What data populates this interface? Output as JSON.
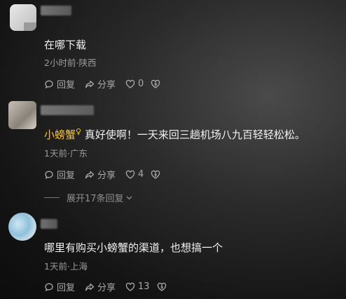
{
  "comments": [
    {
      "text": "在哪下载",
      "time": "2小时前",
      "location": "陕西",
      "reply_label": "回复",
      "share_label": "分享",
      "likes": "0"
    },
    {
      "nickname": "小螃蟹",
      "text": "真好使啊！一天来回三趟机场八九百轻轻松松。",
      "time": "1天前",
      "location": "广东",
      "reply_label": "回复",
      "share_label": "分享",
      "likes": "4",
      "expand_label": "展开17条回复"
    },
    {
      "text": "哪里有购买小螃蟹的渠道，也想搞一个",
      "time": "1天前",
      "location": "上海",
      "reply_label": "回复",
      "share_label": "分享",
      "likes": "13"
    }
  ],
  "colors": {
    "nickname": "#f5c33b",
    "meta": "#9a9a9a",
    "text": "#f1f1f1"
  },
  "icons": [
    "reply-bubble-icon",
    "share-arrow-icon",
    "heart-icon",
    "dislike-heart-icon",
    "chevron-down-icon",
    "female-icon"
  ]
}
